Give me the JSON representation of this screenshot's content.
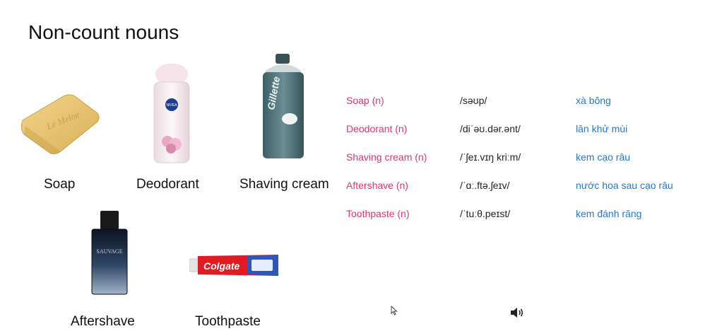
{
  "slide": {
    "title": "Non-count nouns"
  },
  "products": [
    {
      "id": "soap",
      "caption": "Soap",
      "brand_text": "Le Meloe"
    },
    {
      "id": "deodorant",
      "caption": "Deodorant",
      "brand_text": "NIVEA"
    },
    {
      "id": "shaving-cream",
      "caption": "Shaving cream",
      "brand_text": "Gillette"
    },
    {
      "id": "aftershave",
      "caption": "Aftershave",
      "brand_text": "SAUVAGE"
    },
    {
      "id": "toothpaste",
      "caption": "Toothpaste",
      "brand_text": "Colgate"
    }
  ],
  "vocabulary": [
    {
      "word": "Soap (n)",
      "pron": "/səʊp/",
      "meaning": "xà bông"
    },
    {
      "word": "Deodorant (n)",
      "pron": "/diˈəʊ.dər.ənt/",
      "meaning": "lăn khử mùi"
    },
    {
      "word": "Shaving cream (n)",
      "pron": "/ˈʃeɪ.vɪŋ kriːm/",
      "meaning": "kem cạo râu"
    },
    {
      "word": "Aftershave (n)",
      "pron": "/ˈɑː.ftə.ʃeɪv/",
      "meaning": "nước hoa sau cạo râu"
    },
    {
      "word": "Toothpaste (n)",
      "pron": "/ˈtuːθ.peɪst/",
      "meaning": "kem đánh răng"
    }
  ],
  "colors": {
    "word": "#d6396b",
    "pron": "#222222",
    "meaning": "#2b76c6"
  },
  "icons": {
    "speaker": "speaker-icon",
    "cursor": "mouse-cursor-icon"
  }
}
